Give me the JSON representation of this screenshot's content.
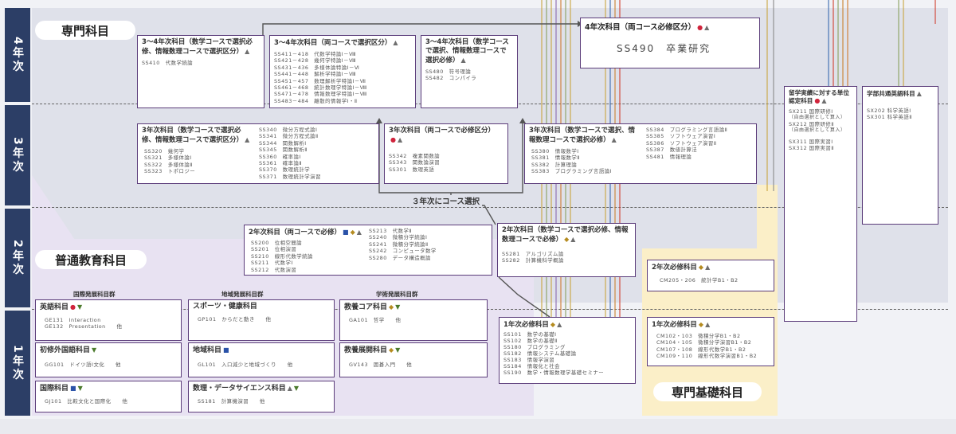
{
  "years": [
    "4年次",
    "3年次",
    "2年次",
    "1年次"
  ],
  "labels": {
    "senmon": "専門科目",
    "futsu": "普通教育科目",
    "kiso": "専門基礎科目",
    "course_select": "３年次にコース選択"
  },
  "groups": {
    "kokusai": "国際発展科目群",
    "chiiki": "地域発展科目群",
    "gakujutsu": "学術発展科目群"
  },
  "y4": {
    "box1": {
      "title": "3～4年次科目（数学コースで選択必修、情報数理コースで選択区分）",
      "sym": "▲",
      "items": [
        "SS410　代数学続論"
      ]
    },
    "box2": {
      "title": "3～4年次科目（両コースで選択区分）",
      "sym": "▲",
      "items": [
        "SS411－418　代数学特論Ⅰ－Ⅷ",
        "SS421－428　幾何学特論Ⅰ－Ⅷ",
        "SS431－436　多様体論特論Ⅰ－Ⅵ",
        "SS441－448　解析学特論Ⅰ－Ⅷ",
        "SS451－457　数理解析学特論Ⅰ－Ⅶ",
        "SS461－468　統計数理学特論Ⅰ－Ⅷ",
        "SS471－478　情報数理学特論Ⅰ－Ⅷ",
        "SS483－484　離散的情報学Ⅰ・Ⅱ"
      ]
    },
    "box3": {
      "title": "3～4年次科目（数学コースで選択、情報数理コースで選択必修）",
      "sym": "▲",
      "items": [
        "SS480　符号理論",
        "SS482　コンパイラ"
      ]
    },
    "box4": {
      "title": "4年次科目（両コース必修区分）",
      "sym1": "●",
      "sym2": "▲",
      "items": [
        "SS490　卒業研究"
      ]
    },
    "ryugaku": {
      "title": "留学実績に対する単位認定科目",
      "sym1": "●",
      "sym2": "▲",
      "items": [
        "SX211 国際研修Ⅰ",
        "（自由選択として算入）",
        "SX212 国際研修Ⅱ",
        "（自由選択として算入）",
        "SX311 国際実習Ⅰ",
        "SX312 国際実習Ⅱ"
      ]
    },
    "eigo": {
      "title": "学部共通英語科目",
      "sym": "▲",
      "items": [
        "SX202 科学英語Ⅰ",
        "SX301 科学英語Ⅱ"
      ]
    }
  },
  "y3": {
    "box1": {
      "title": "3年次科目（数学コースで選択必修、情報数理コースで選択区分）",
      "sym": "▲",
      "col1": [
        "SS320　幾何学",
        "SS321　多様体論Ⅰ",
        "SS322　多様体論Ⅱ",
        "SS323　トポロジー"
      ],
      "col2": [
        "SS340　微分方程式論Ⅰ",
        "SS341　微分方程式論Ⅱ",
        "SS344　関数解析Ⅰ",
        "SS345　関数解析Ⅱ",
        "SS360　確率論Ⅰ",
        "SS361　確率論Ⅱ",
        "SS370　数理統計学",
        "SS371　数理統計学演習"
      ]
    },
    "box2": {
      "title": "3年次科目（両コースで必修区分）",
      "sym1": "●",
      "sym2": "▲",
      "items": [
        "SS342　複素関数論",
        "SS343　関数論演習",
        "SS301　数理英語"
      ]
    },
    "box3": {
      "title": "3年次科目（数学コースで選択、情報数理コースで選択必修）",
      "sym": "▲",
      "col1": [
        "SS380　情報数学Ⅰ",
        "SS381　情報数学Ⅱ",
        "SS382　計算理論",
        "SS383　プログラミング言語論Ⅰ"
      ],
      "col2": [
        "SS384　プログラミング言語論Ⅱ",
        "SS385　ソフトウェア演習Ⅰ",
        "SS386　ソフトウェア演習Ⅱ",
        "SS387　数値計算法",
        "SS481　情報理論"
      ]
    }
  },
  "y2": {
    "box1": {
      "title": "2年次科目（両コースで必修）",
      "sym1": "■",
      "sym2": "◆",
      "sym3": "▲",
      "col1": [
        "SS200　位相空間論",
        "SS201　位相演習",
        "SS210　線形代数学続論",
        "SS211　代数学Ⅰ",
        "SS212　代数演習"
      ],
      "col2": [
        "SS213　代数学Ⅱ",
        "SS240　微積分学続論Ⅰ",
        "SS241　微積分学続論Ⅱ",
        "SS242　コンピュータ数学",
        "SS280　データ構造概論"
      ]
    },
    "box2": {
      "title": "2年次科目（数学コースで選択必修、情報数理コースで必修）",
      "sym1": "◆",
      "sym2": "▲",
      "items": [
        "SS281　アルゴリズム論",
        "SS282　計算機科学概論"
      ]
    },
    "kiso": {
      "title": "2年次必修科目",
      "sym1": "◆",
      "sym2": "▲",
      "items": [
        "CM205・206　統計学B1・B2"
      ]
    }
  },
  "y1": {
    "senmon": {
      "title": "1年次必修科目",
      "sym1": "◆",
      "sym2": "▲",
      "items": [
        "SS101　数学の基礎Ⅰ",
        "SS102　数学の基礎Ⅱ",
        "SS180　プログラミング",
        "SS182　情報システム基礎論",
        "SS183　情報学演習",
        "SS184　情報化と社会",
        "SS190　数学・情報数理学基礎セミナー"
      ]
    },
    "kiso": {
      "title": "1年次必修科目",
      "sym1": "◆",
      "sym2": "▲",
      "items": [
        "CM102・103　微積分学B1・B2",
        "CM104・105　微積分学演習B1・B2",
        "CM107・108　線形代数学B1・B2",
        "CM109・110　線形代数学演習B1・B2"
      ]
    },
    "eigo": {
      "title": "英語科目",
      "sym1": "●",
      "sym2": "▼",
      "items": [
        "GE131　Interaction",
        "GE132　Presentation　　他"
      ]
    },
    "shoshu": {
      "title": "初修外国語科目",
      "sym": "▼",
      "items": [
        "GG101　ドイツ語Ⅰ文化　　他"
      ]
    },
    "kokusai": {
      "title": "国際科目",
      "sym1": "■",
      "sym2": "▼",
      "items": [
        "GJ101　比較文化と国際化　　他"
      ]
    },
    "sports": {
      "title": "スポーツ・健康科目",
      "items": [
        "GP101　からだと動き　　他"
      ]
    },
    "chiiki": {
      "title": "地域科目",
      "sym": "■",
      "items": [
        "GL101　入口減少と地域づくり　　他"
      ]
    },
    "data": {
      "title": "数理・データサイエンス科目",
      "sym1": "▲",
      "sym2": "▼",
      "items": [
        "SS181　計算機演習　　他"
      ]
    },
    "core": {
      "title": "教養コア科目",
      "sym1": "◆",
      "sym2": "▼",
      "items": [
        "GA101　哲学　　他"
      ]
    },
    "tenkai": {
      "title": "教養展開科目",
      "sym1": "◆",
      "sym2": "▼",
      "items": [
        "GV143　囲碁入門　　他"
      ]
    }
  }
}
